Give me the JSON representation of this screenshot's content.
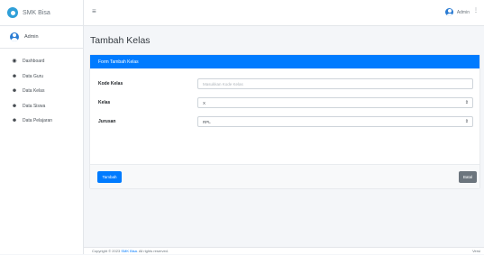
{
  "brand": {
    "name": "SMK Bisa"
  },
  "user": {
    "name": "Admin"
  },
  "sidebar": {
    "items": [
      {
        "label": "Dashboard",
        "icon": "dashboard-icon"
      },
      {
        "label": "Data Guru",
        "icon": "users-icon"
      },
      {
        "label": "Data Kelas",
        "icon": "users-icon"
      },
      {
        "label": "Data Siswa",
        "icon": "users-icon"
      },
      {
        "label": "Data Pelajaran",
        "icon": "users-icon"
      }
    ]
  },
  "topbar": {
    "user_name": "Admin"
  },
  "page": {
    "title": "Tambah Kelas"
  },
  "form": {
    "header": "Form Tambah Kelas",
    "fields": [
      {
        "label": "Kode Kelas",
        "placeholder": "Masukkan Kode Kelas",
        "value": ""
      },
      {
        "label": "Kelas",
        "value": "X"
      },
      {
        "label": "Jurusan",
        "value": "RPL"
      }
    ],
    "submit_label": "Tambah",
    "cancel_label": "Batal"
  },
  "footer": {
    "prefix": "Copyright © 2023 ",
    "brand": "SMK Bisa",
    "suffix": ". All rights reserved.",
    "version": "Versi"
  },
  "colors": {
    "primary": "#007bff",
    "secondary": "#6c757d",
    "brand_logo": "#2f9fd8"
  }
}
